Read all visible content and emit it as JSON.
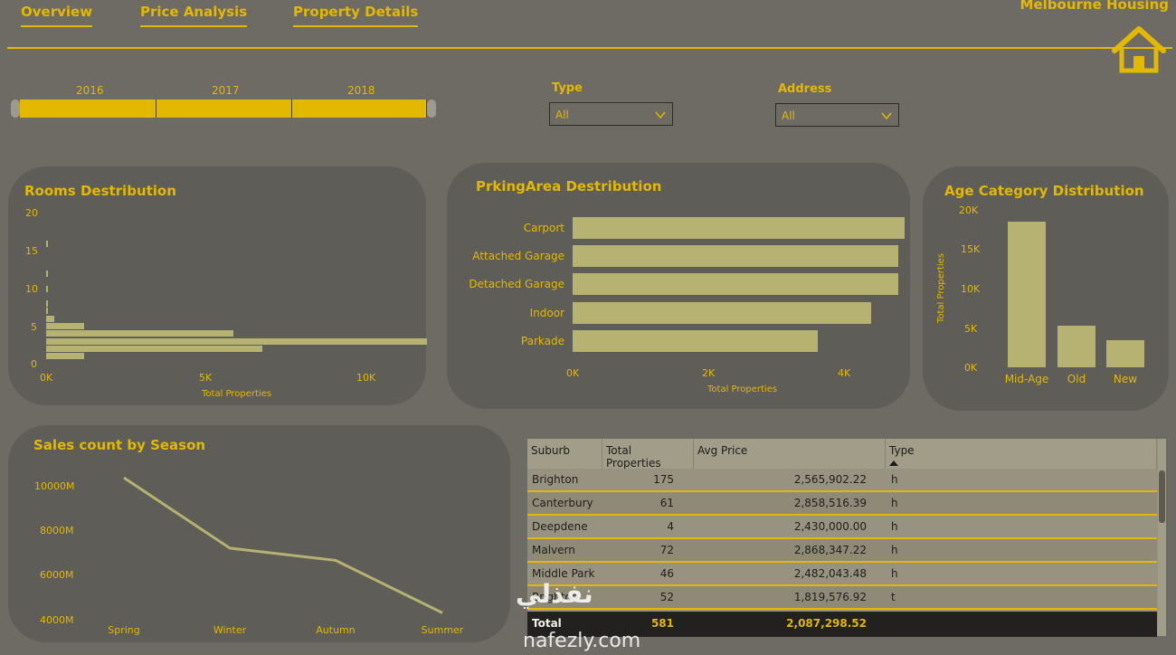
{
  "nav": {
    "tabs": [
      {
        "label": "Overview"
      },
      {
        "label": "Price Analysis"
      },
      {
        "label": "Property Details"
      }
    ],
    "app_title": "Melbourne Housing"
  },
  "year_slider": {
    "years": [
      "2016",
      "2017",
      "2018"
    ]
  },
  "filters": {
    "type": {
      "label": "Type",
      "value": "All"
    },
    "address": {
      "label": "Address",
      "value": "All"
    }
  },
  "colors": {
    "accent": "#e3b800",
    "bar": "#b6b272",
    "background": "#6e6b64",
    "card": "#5f5d57"
  },
  "icons": {
    "home": "home-icon",
    "dropdown": "chevron-down-icon"
  },
  "rooms_card": {
    "title": "Rooms Destribution",
    "y_ticks": [
      "20",
      "15",
      "10",
      "5",
      "0"
    ],
    "x_ticks": [
      "0K",
      "5K",
      "10K"
    ],
    "x_title": "Total Properties"
  },
  "parking_card": {
    "title": "PrkingArea Destribution",
    "x_ticks": [
      "0K",
      "2K",
      "4K"
    ],
    "x_title": "Total Properties"
  },
  "age_card": {
    "title": "Age Category Distribution",
    "y_ticks": [
      "20K",
      "15K",
      "10K",
      "5K",
      "0K"
    ],
    "y_title": "Total Properties"
  },
  "season_card": {
    "title": "Sales count by Season",
    "y_ticks": [
      "10000M",
      "8000M",
      "6000M",
      "4000M"
    ]
  },
  "table": {
    "headers": [
      "Suburb",
      "Total Properties",
      "Avg Price",
      "Type"
    ],
    "rows": [
      [
        "Brighton",
        "175",
        "2,565,902.22",
        "h"
      ],
      [
        "Canterbury",
        "61",
        "2,858,516.39",
        "h"
      ],
      [
        "Deepdene",
        "4",
        "2,430,000.00",
        "h"
      ],
      [
        "Malvern",
        "72",
        "2,868,347.22",
        "h"
      ],
      [
        "Middle Park",
        "46",
        "2,482,043.48",
        "h"
      ],
      [
        "Brighton",
        "52",
        "1,819,576.92",
        "t"
      ]
    ],
    "total": [
      "Total",
      "581",
      "2,087,298.52"
    ]
  },
  "watermark": {
    "text": "نفذلي",
    "sub": "nafezly.com"
  },
  "chart_data": [
    {
      "type": "bar",
      "orientation": "horizontal",
      "title": "Rooms Destribution",
      "xlabel": "Total Properties",
      "ylabel": "",
      "xlim": [
        0,
        12000
      ],
      "ylim": [
        0,
        20
      ],
      "categories": [
        1,
        2,
        3,
        4,
        5,
        6,
        7,
        8,
        10,
        12,
        16
      ],
      "values": [
        1200,
        6800,
        12000,
        5900,
        1200,
        250,
        60,
        20,
        10,
        5,
        5
      ]
    },
    {
      "type": "bar",
      "orientation": "horizontal",
      "title": "PrkingArea Destribution",
      "xlabel": "Total Properties",
      "ylabel": "",
      "xlim": [
        0,
        5000
      ],
      "categories": [
        "Carport",
        "Attached Garage",
        "Detached Garage",
        "Indoor",
        "Parkade"
      ],
      "values": [
        4950,
        4850,
        4850,
        4450,
        3650
      ]
    },
    {
      "type": "bar",
      "title": "Age Category Distribution",
      "xlabel": "",
      "ylabel": "Total Properties",
      "ylim": [
        0,
        20000
      ],
      "categories": [
        "Mid-Age",
        "Old",
        "New"
      ],
      "values": [
        18500,
        5300,
        3400
      ]
    },
    {
      "type": "line",
      "title": "Sales count by Season",
      "xlabel": "",
      "ylabel": "",
      "ylim": [
        4000,
        10000
      ],
      "categories": [
        "Spring",
        "Winter",
        "Autumn",
        "Summer"
      ],
      "values": [
        10400,
        7250,
        6700,
        4350
      ]
    }
  ]
}
